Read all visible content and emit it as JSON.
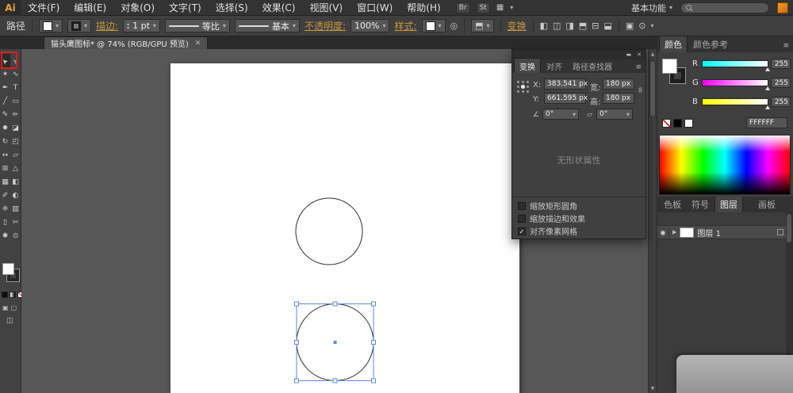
{
  "colors": {
    "selection_blue": "#5b8cd8",
    "annotation_red": "#e01b1b",
    "link_amber": "#c8973f",
    "logo_amber": "#e8a33d"
  },
  "menubar": {
    "logo": "Ai",
    "items": [
      "文件(F)",
      "编辑(E)",
      "对象(O)",
      "文字(T)",
      "选择(S)",
      "效果(C)",
      "视图(V)",
      "窗口(W)",
      "帮助(H)"
    ],
    "br": "Br",
    "st": "St",
    "workspace": "基本功能",
    "search_value": ""
  },
  "controlbar": {
    "context_label": "路径",
    "stroke_label": "描边:",
    "stroke_width": "1 pt",
    "profile": "等比",
    "brush": "基本",
    "opacity_label": "不透明度:",
    "opacity_value": "100%",
    "style_label": "样式:",
    "transform_link": "变换"
  },
  "tabbar": {
    "doc_title": "猫头鹰图标* @ 74% (RGB/GPU 预览)"
  },
  "toolbar": {
    "tools": [
      {
        "name": "selection-tool",
        "glyph": "➤"
      },
      {
        "name": "direct-selection-tool",
        "glyph": "➢"
      },
      {
        "name": "magic-wand-tool",
        "glyph": "✶"
      },
      {
        "name": "lasso-tool",
        "glyph": "∿"
      },
      {
        "name": "pen-tool",
        "glyph": "✒"
      },
      {
        "name": "type-tool",
        "glyph": "T"
      },
      {
        "name": "line-segment-tool",
        "glyph": "╱"
      },
      {
        "name": "rectangle-tool",
        "glyph": "▭"
      },
      {
        "name": "paintbrush-tool",
        "glyph": "✎"
      },
      {
        "name": "pencil-tool",
        "glyph": "✏"
      },
      {
        "name": "blob-brush-tool",
        "glyph": "✹"
      },
      {
        "name": "eraser-tool",
        "glyph": "◪"
      },
      {
        "name": "rotate-tool",
        "glyph": "↻"
      },
      {
        "name": "scale-tool",
        "glyph": "◰"
      },
      {
        "name": "width-tool",
        "glyph": "↔"
      },
      {
        "name": "free-transform-tool",
        "glyph": "▱"
      },
      {
        "name": "shape-builder-tool",
        "glyph": "⊞"
      },
      {
        "name": "perspective-grid-tool",
        "glyph": "△"
      },
      {
        "name": "mesh-tool",
        "glyph": "▦"
      },
      {
        "name": "gradient-tool",
        "glyph": "◧"
      },
      {
        "name": "eyedropper-tool",
        "glyph": "✐"
      },
      {
        "name": "blend-tool",
        "glyph": "◐"
      },
      {
        "name": "symbol-sprayer-tool",
        "glyph": "❈"
      },
      {
        "name": "column-graph-tool",
        "glyph": "▥"
      },
      {
        "name": "artboard-tool",
        "glyph": "▯"
      },
      {
        "name": "slice-tool",
        "glyph": "✂"
      },
      {
        "name": "hand-tool",
        "glyph": "✱"
      },
      {
        "name": "zoom-tool",
        "glyph": "⊙"
      }
    ]
  },
  "transform_panel": {
    "tabs": [
      "变换",
      "对齐",
      "路径查找器"
    ],
    "x_label": "X:",
    "x_value": "383.541 px",
    "y_label": "Y:",
    "y_value": "661.595 px",
    "w_label": "宽:",
    "w_value": "180 px",
    "h_label": "高:",
    "h_value": "180 px",
    "rotate_value": "0°",
    "shear_value": "0°",
    "empty_text": "无形状属性",
    "checkboxes": [
      {
        "label": "缩放矩形圆角",
        "mark": ""
      },
      {
        "label": "缩放描边和效果",
        "mark": ""
      },
      {
        "label": "对齐像素网格",
        "mark": "✓"
      }
    ]
  },
  "color_panel": {
    "tabs": [
      "颜色",
      "颜色参考"
    ],
    "channels": [
      {
        "label": "R",
        "value": "255"
      },
      {
        "label": "G",
        "value": "255"
      },
      {
        "label": "B",
        "value": "255"
      }
    ],
    "hex": "FFFFFF"
  },
  "panel_tabs": [
    "色板",
    "符号",
    "图层",
    "画板"
  ],
  "layers": {
    "layer_name": "图层 1"
  },
  "icons": {
    "dropdown": "▾",
    "spin_up": "▴",
    "spin_down": "▾",
    "arrange_documents": "▦",
    "recolor": "◎",
    "align_options": "⬒",
    "align_left": "◧",
    "align_hcenter": "◫",
    "align_right": "◨",
    "align_top": "⬒",
    "align_vcenter": "⊟",
    "align_bottom": "⬓",
    "isolate": "▣",
    "select_similar": "⊙",
    "menu": "≡",
    "close": "✕",
    "minimize": "▬",
    "chain": "∞",
    "rotate": "∠",
    "shear": "▱",
    "eye": "◉",
    "expand": "▶",
    "scroll_up": "▲",
    "scroll_down": "▼",
    "doc_close": "✕",
    "draw_mode": "▣",
    "draw_mode2": "▢",
    "screen_mode": "◫"
  }
}
